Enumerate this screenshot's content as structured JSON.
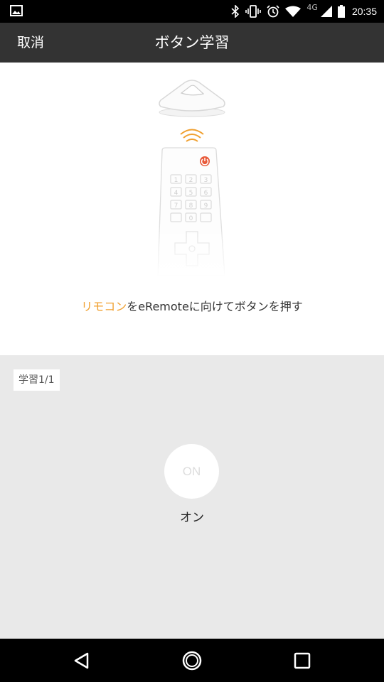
{
  "status_bar": {
    "time": "20:35",
    "network": "4G",
    "icons": [
      "image-icon",
      "bluetooth-icon",
      "vibrate-icon",
      "alarm-icon",
      "wifi-icon",
      "signal-icon",
      "battery-icon"
    ]
  },
  "toolbar": {
    "cancel_label": "取消",
    "title": "ボタン学習"
  },
  "illustration": {
    "keypad": [
      "1",
      "2",
      "3",
      "4",
      "5",
      "6",
      "7",
      "8",
      "9",
      "",
      "0",
      ""
    ],
    "accent_color": "#f0a030",
    "power_color": "#e85a3a"
  },
  "instruction": {
    "highlight": "リモコン",
    "text": "をeRemoteに向けてボタンを押す"
  },
  "learn": {
    "progress_label": "学習1/1",
    "button_text": "ON",
    "button_label": "オン"
  },
  "nav_bar": {
    "icons": [
      "back-icon",
      "home-icon",
      "recents-icon"
    ]
  }
}
